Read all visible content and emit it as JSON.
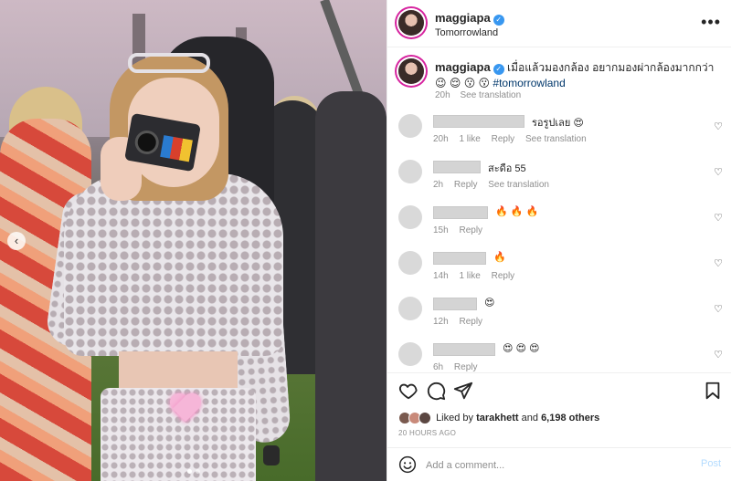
{
  "post": {
    "username": "maggiapa",
    "location": "Tomorrowland",
    "caption_text": "เมื่อแล้วมองกล้อง อยากมองผ่ากล้องมากกว่า 😉 😌 😗 😗",
    "caption_tag": "#tomorrowland",
    "caption_time": "20h",
    "see_translation": "See translation",
    "likes_prefix": "Liked by",
    "likes_user": "tarakhett",
    "likes_and": "and",
    "likes_count": "6,198 others",
    "time_ago": "20 HOURS AGO",
    "carousel_prev": "‹",
    "more": "•••"
  },
  "comments": [
    {
      "text": "รอรูปเลย 😍",
      "time": "20h",
      "likes": "1 like",
      "reply": "Reply",
      "translation": "See translation"
    },
    {
      "text": "สะดือ 55",
      "time": "2h",
      "likes": "",
      "reply": "Reply",
      "translation": "See translation"
    },
    {
      "text": "🔥 🔥 🔥",
      "time": "15h",
      "likes": "",
      "reply": "Reply",
      "translation": ""
    },
    {
      "text": "🔥",
      "time": "14h",
      "likes": "1 like",
      "reply": "Reply",
      "translation": ""
    },
    {
      "text": "😍",
      "time": "12h",
      "likes": "",
      "reply": "Reply",
      "translation": ""
    },
    {
      "text": "😍 😍 😍",
      "time": "6h",
      "likes": "",
      "reply": "Reply",
      "translation": ""
    }
  ],
  "add_comment": {
    "placeholder": "Add a comment...",
    "post_label": "Post"
  },
  "icons": [
    "more-icon",
    "heart-icon",
    "comment-icon",
    "share-icon",
    "bookmark-icon",
    "emoji-icon",
    "verified-icon"
  ],
  "colors": {
    "verified": "#3897f0",
    "post_disabled": "#b3dbff",
    "meta": "#8e8e8e",
    "heart_sticker": "#f6b6d8"
  }
}
